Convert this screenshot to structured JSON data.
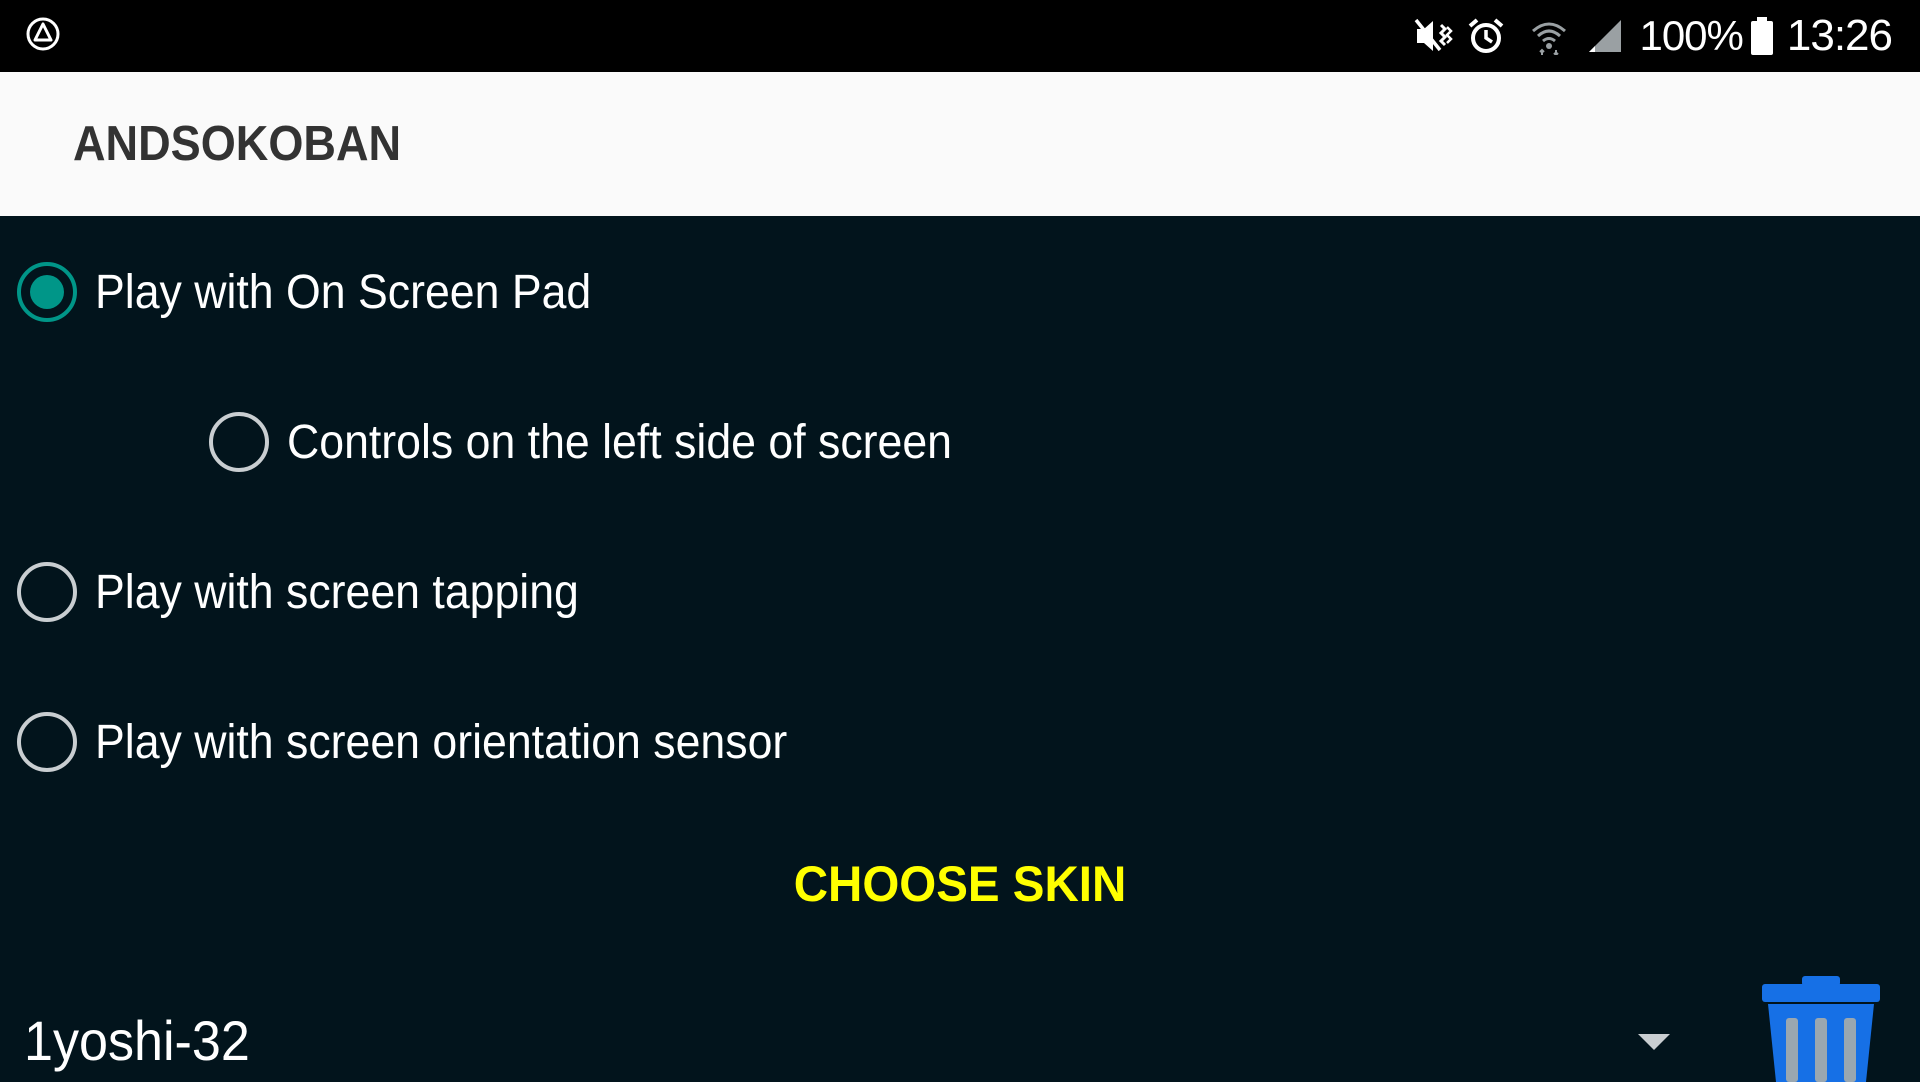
{
  "status_bar": {
    "left_icon": "android-auto-icon",
    "icons": [
      "mute-vibrate-icon",
      "alarm-icon",
      "wifi-icon",
      "cell-signal-icon",
      "battery-icon"
    ],
    "battery": "100%",
    "time": "13:26"
  },
  "app_bar": {
    "title": "ANDSOKOBAN"
  },
  "options": {
    "on_screen_pad": {
      "label": "Play with On Screen Pad",
      "checked": true
    },
    "left_controls": {
      "label": "Controls on the left side of screen",
      "checked": false
    },
    "screen_tapping": {
      "label": "Play with screen tapping",
      "checked": false
    },
    "orientation_sensor": {
      "label": "Play with screen orientation sensor",
      "checked": false
    }
  },
  "skin": {
    "choose_label": "CHOOSE SKIN",
    "selected": "1yoshi-32",
    "delete_icon": "trash-icon"
  },
  "colors": {
    "background": "#02141c",
    "accent": "#009688",
    "highlight": "#ffff00",
    "trash": "#1670e6"
  }
}
